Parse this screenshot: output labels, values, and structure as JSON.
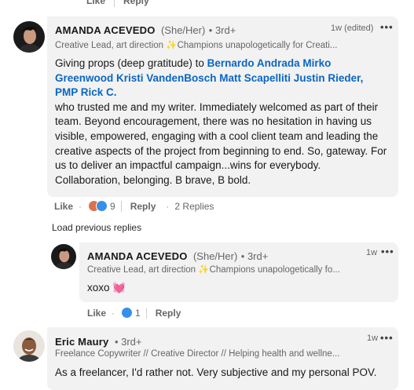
{
  "top_actions": {
    "like": "Like",
    "reply": "Reply"
  },
  "comment1": {
    "name": "AMANDA ACEVEDO",
    "pronouns": "(She/Her)",
    "degree": "• 3rd+",
    "headline": "Creative Lead, art direction ✨Champions unapologetically for Creati...",
    "time": "1w (edited)",
    "text_intro": "Giving props (deep gratitude) to ",
    "mentions": "Bernardo Andrada Mirko Greenwood Kristi VandenBosch Matt Scapelliti Justin Rieder, PMP Rick C.",
    "text_body": "who trusted me and my writer. Immediately welcomed as part of their team. Beyond encouragement, there was no hesitation in having us visible, empowered, engaging with a cool client team and leading the creative aspects of the project from beginning to end. So, gateway. For us to deliver an impactful campaign...wins for everybody. Collaboration, belonging. B brave, B bold.",
    "actions": {
      "like": "Like",
      "dot": "·",
      "reaction_count": "9",
      "reply": "Reply",
      "dot2": "·",
      "replies": "2 Replies"
    }
  },
  "load_previous": "Load previous replies",
  "reply1": {
    "name": "AMANDA ACEVEDO",
    "pronouns": "(She/Her)",
    "degree": "• 3rd+",
    "headline": "Creative Lead, art direction ✨Champions unapologetically fo...",
    "time": "1w",
    "text": "xoxo 💓",
    "actions": {
      "like": "Like",
      "dot": "·",
      "reaction_count": "1",
      "reply": "Reply"
    }
  },
  "comment2": {
    "name": "Eric Maury",
    "degree": "• 3rd+",
    "headline": "Freelance Copywriter // Creative Director // Helping health and wellne...",
    "time": "1w",
    "text": "As a freelancer, I'd rather not. Very subjective and my personal POV."
  },
  "colors": {
    "bubble": "#f2f2f2",
    "mention": "#0a66c2",
    "muted": "#666666"
  }
}
